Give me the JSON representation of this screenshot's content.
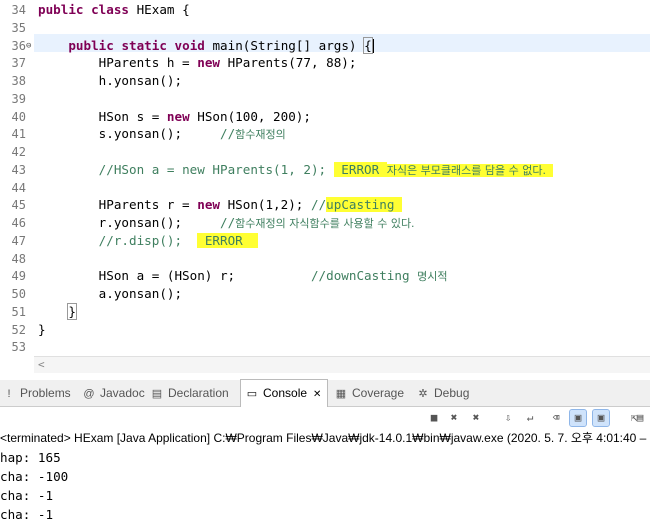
{
  "editor": {
    "lines": [
      {
        "n": "34",
        "segs": [
          {
            "t": "public",
            "c": "kw"
          },
          {
            "t": " "
          },
          {
            "t": "class",
            "c": "kw"
          },
          {
            "t": " HExam {"
          }
        ]
      },
      {
        "n": "35",
        "segs": []
      },
      {
        "n": "36",
        "fold": "⊖",
        "segs": [
          {
            "t": "    "
          },
          {
            "t": "public",
            "c": "kw"
          },
          {
            "t": " "
          },
          {
            "t": "static",
            "c": "kw"
          },
          {
            "t": " "
          },
          {
            "t": "void",
            "c": "kw"
          },
          {
            "t": " main(String[] args) "
          },
          {
            "t": "{",
            "c": "brk"
          }
        ]
      },
      {
        "n": "37",
        "segs": [
          {
            "t": "        HParents h = "
          },
          {
            "t": "new",
            "c": "kw"
          },
          {
            "t": " HParents(77, 88);"
          }
        ]
      },
      {
        "n": "38",
        "segs": [
          {
            "t": "        h.yonsan();"
          }
        ]
      },
      {
        "n": "39",
        "segs": []
      },
      {
        "n": "40",
        "segs": [
          {
            "t": "        HSon s = "
          },
          {
            "t": "new",
            "c": "kw"
          },
          {
            "t": " HSon(100, 200);"
          }
        ]
      },
      {
        "n": "41",
        "segs": [
          {
            "t": "        s.yonsan();     "
          },
          {
            "t": "//",
            "c": "cm"
          },
          {
            "t": "함수재정의",
            "c": "cm ko"
          }
        ]
      },
      {
        "n": "42",
        "segs": []
      },
      {
        "n": "43",
        "segs": [
          {
            "t": "        "
          },
          {
            "t": "//HSon a = new HParents(1, 2); ",
            "c": "cm"
          },
          {
            "t": " ERROR ",
            "c": "cm hl"
          },
          {
            "t": "자식은 부모클래스를 담을 수 없다.  ",
            "c": "cm hl ko"
          }
        ]
      },
      {
        "n": "44",
        "segs": []
      },
      {
        "n": "45",
        "segs": [
          {
            "t": "        HParents r = "
          },
          {
            "t": "new",
            "c": "kw"
          },
          {
            "t": " HSon(1,2); "
          },
          {
            "t": "//",
            "c": "cm"
          },
          {
            "t": "upCasting ",
            "c": "cm hl"
          }
        ]
      },
      {
        "n": "46",
        "segs": [
          {
            "t": "        r.yonsan();     "
          },
          {
            "t": "//",
            "c": "cm"
          },
          {
            "t": "함수재정의 자식함수를 사용할 수 있다.",
            "c": "cm ko"
          }
        ]
      },
      {
        "n": "47",
        "segs": [
          {
            "t": "        "
          },
          {
            "t": "//r.disp();  ",
            "c": "cm"
          },
          {
            "t": " ERROR  ",
            "c": "cm hl"
          }
        ]
      },
      {
        "n": "48",
        "segs": []
      },
      {
        "n": "49",
        "segs": [
          {
            "t": "        HSon a = (HSon) r;          "
          },
          {
            "t": "//downCasting ",
            "c": "cm"
          },
          {
            "t": "명시적",
            "c": "cm ko"
          }
        ]
      },
      {
        "n": "50",
        "segs": [
          {
            "t": "        a.yonsan();"
          }
        ]
      },
      {
        "n": "51",
        "segs": [
          {
            "t": "    "
          },
          {
            "t": "}",
            "c": "brk"
          }
        ]
      },
      {
        "n": "52",
        "segs": [
          {
            "t": "}"
          }
        ]
      },
      {
        "n": "53",
        "segs": []
      }
    ]
  },
  "tabs": [
    {
      "label": "Problems",
      "icon": "!",
      "name": "problems"
    },
    {
      "label": "Javadoc",
      "icon": "@",
      "name": "javadoc"
    },
    {
      "label": "Declaration",
      "icon": "▤",
      "name": "declaration"
    },
    {
      "label": "Console",
      "icon": "▭",
      "name": "console",
      "active": true,
      "close": "✕"
    },
    {
      "label": "Coverage",
      "icon": "▦",
      "name": "coverage"
    },
    {
      "label": "Debug",
      "icon": "✲",
      "name": "debug"
    }
  ],
  "console": {
    "status": "<terminated> HExam [Java Application] C:₩Program Files₩Java₩jdk-14.0.1₩bin₩javaw.exe  (2020. 5. 7. 오후 4:01:40 – ...",
    "output": [
      "hap: 165",
      "cha: -100",
      "cha: -1",
      "cha: -1"
    ]
  },
  "toolbar": {
    "icons": [
      {
        "name": "terminate-icon",
        "glyph": "■"
      },
      {
        "name": "remove-launch-icon",
        "glyph": "✖"
      },
      {
        "name": "remove-all-terminated-icon",
        "glyph": "✖"
      },
      {
        "name": "scroll-lock-icon",
        "glyph": "⇩"
      },
      {
        "name": "word-wrap-icon",
        "glyph": "↵"
      },
      {
        "name": "clear-console-icon",
        "glyph": "⌫"
      },
      {
        "name": "show-when-stdout-icon",
        "glyph": "▣"
      },
      {
        "name": "show-when-stderr-icon",
        "glyph": "▣"
      },
      {
        "name": "pin-console-icon",
        "glyph": "⇱"
      },
      {
        "name": "new-console-icon",
        "glyph": "▤"
      }
    ]
  },
  "colors": {
    "keyword": "#7f0055",
    "comment": "#3f7f5f",
    "highlight": "#ffff33",
    "current_line": "#e8f2fe"
  }
}
